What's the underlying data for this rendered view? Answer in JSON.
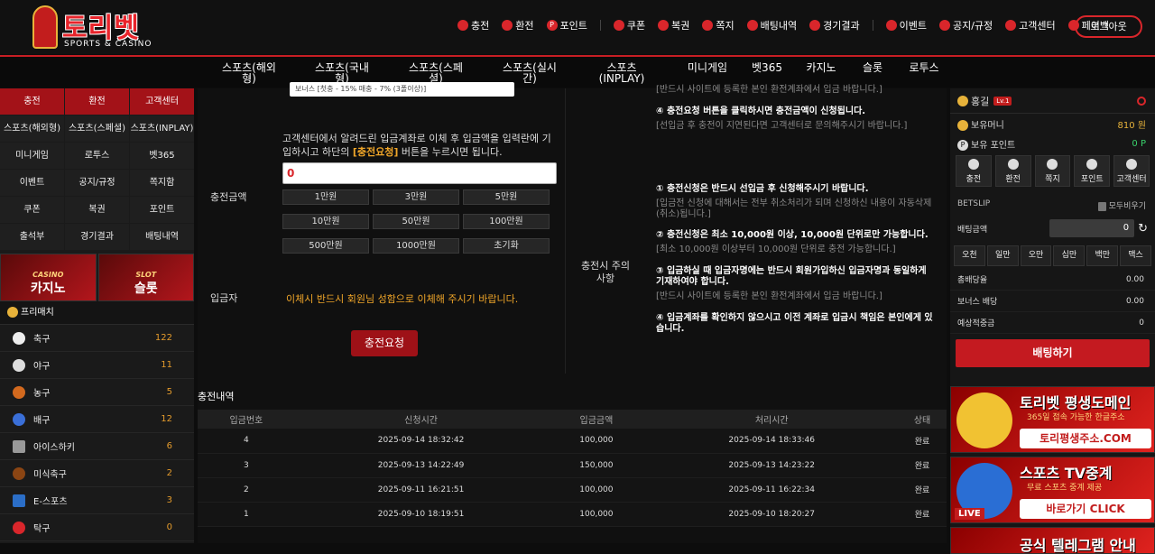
{
  "header": {
    "logo_title": "토리벳",
    "logo_sub": "SPORTS & CASINO",
    "nav": [
      "충전",
      "환전",
      "포인트",
      "쿠폰",
      "복권",
      "쪽지",
      "배팅내역",
      "경기결과",
      "이벤트",
      "공지/규정",
      "고객센터",
      "페이백"
    ],
    "logout": "로그아웃"
  },
  "mainnav": [
    "스포츠(해외형)",
    "스포츠(국내형)",
    "스포츠(스페셜)",
    "스포츠(실시간)",
    "스포츠(INPLAY)",
    "미니게임",
    "벳365",
    "카지노",
    "슬롯",
    "로투스"
  ],
  "left": {
    "grid": [
      "충전",
      "환전",
      "고객센터",
      "스포츠(해외형)",
      "스포츠(스페셜)",
      "스포츠(INPLAY)",
      "미니게임",
      "로투스",
      "벳365",
      "이벤트",
      "공지/규정",
      "쪽지함",
      "쿠폰",
      "복권",
      "포인트",
      "출석부",
      "경기결과",
      "배팅내역"
    ],
    "banner_casino_small": "CASINO",
    "banner_casino": "카지노",
    "banner_slot_small": "SLOT",
    "banner_slot": "슬롯",
    "freematch": "프리매치",
    "sports": [
      {
        "name": "축구",
        "count": "122"
      },
      {
        "name": "야구",
        "count": "11"
      },
      {
        "name": "농구",
        "count": "5"
      },
      {
        "name": "배구",
        "count": "12"
      },
      {
        "name": "아이스하키",
        "count": "6"
      },
      {
        "name": "미식축구",
        "count": "2"
      },
      {
        "name": "E-스포츠",
        "count": "3"
      },
      {
        "name": "탁구",
        "count": "0"
      }
    ]
  },
  "form": {
    "select_value": "보너스 [첫충 - 15% 매충 - 7% (3폴이상)]",
    "instruction_1": "고객센터에서 알려드린 입금계좌로 이체 후 입금액을 입력란에 기입하시고 하단의 ",
    "instruction_bold": "[충전요청]",
    "instruction_2": " 버튼을 누르시면 됩니다.",
    "amount_label": "충전금액",
    "amount_value": "0",
    "amount_buttons": [
      "1만원",
      "3만원",
      "5만원",
      "10만원",
      "50만원",
      "100만원",
      "500만원",
      "1000만원",
      "초기화"
    ],
    "depositor_label": "입금자",
    "depositor_note": "이체시 반드시 회원님 성함으로 이체해 주시기 바랍니다.",
    "submit": "충전요청"
  },
  "notice": {
    "label": "충전시 주의사항",
    "lines": [
      {
        "style": "g",
        "text": "[반드시 사이트에 등록한 본인 환전계좌에서 입금 바랍니다.]"
      },
      {
        "style": "b",
        "text": "④ 충전요청 버튼을 클릭하시면 충전금액이 신청됩니다."
      },
      {
        "style": "g",
        "text": "[선입금 후 충전이 지연된다면 고객센터로 문의해주시기 바랍니다.]"
      },
      {
        "style": "b",
        "text": "① 충전신청은 반드시 선입금 후 신청해주시기 바랍니다."
      },
      {
        "style": "g",
        "text": "[입금전 신청에 대해서는 전부 취소처리가 되며 신청하신 내용이 자동삭제(취소)됩니다.]"
      },
      {
        "style": "b",
        "text": "② 충전신청은 최소 10,000원 이상, 10,000원 단위로만 가능합니다."
      },
      {
        "style": "g",
        "text": "[최소 10,000원 이상부터 10,000원 단위로 충전 가능합니다.]"
      },
      {
        "style": "b",
        "text": "③ 입금하실 때 입금자명에는 반드시 회원가입하신 입금자명과 동일하게 기재하여야 합니다."
      },
      {
        "style": "g",
        "text": "[반드시 사이트에 등록한 본인 환전계좌에서 입금 바랍니다.]"
      },
      {
        "style": "b",
        "text": "④ 입금계좌를 확인하지 않으시고 이전 계좌로 입금시 책임은 본인에게 있습니다."
      }
    ]
  },
  "history": {
    "title": "충전내역",
    "headers": [
      "입금번호",
      "신청시간",
      "입금금액",
      "처리시간",
      "상태"
    ],
    "rows": [
      [
        "4",
        "2025-09-14 18:32:42",
        "100,000",
        "2025-09-14 18:33:46",
        "완료"
      ],
      [
        "3",
        "2025-09-13 14:22:49",
        "150,000",
        "2025-09-13 14:23:22",
        "완료"
      ],
      [
        "2",
        "2025-09-11 16:21:51",
        "100,000",
        "2025-09-11 16:22:34",
        "완료"
      ],
      [
        "1",
        "2025-09-10 18:19:51",
        "100,000",
        "2025-09-10 18:20:27",
        "완료"
      ]
    ]
  },
  "right": {
    "user": "홍길",
    "level": "Lv.1",
    "money_label": "보유머니",
    "money_value": "810 원",
    "point_label": "보유 포인트",
    "point_value": "0 P",
    "quick": [
      "충전",
      "환전",
      "쪽지",
      "포인트",
      "고객센터"
    ],
    "betslip": "BETSLIP",
    "clear_all": "모두비우기",
    "bet_amount_label": "배팅금액",
    "bet_amount_value": "0",
    "chips": [
      "오천",
      "일만",
      "오만",
      "십만",
      "백만",
      "맥스"
    ],
    "total_odds_label": "총배당율",
    "total_odds_value": "0.00",
    "bonus_label": "보너스 배당",
    "bonus_value": "0.00",
    "expected_label": "예상적중금",
    "expected_value": "0",
    "bet_button": "배팅하기",
    "ad1_title": "토리벳 평생도메인",
    "ad1_sub": "365일 접속 가능한 한글주소",
    "ad1_url": "토리평생주소.COM",
    "ad2_title": "스포츠 TV중계",
    "ad2_sub": "무료 스포츠 중계 제공",
    "ad2_cta": "바로가기 CLICK",
    "ad2_live": "LIVE",
    "ad3_title": "공식 텔레그램 안내"
  },
  "colors": {
    "accent": "#c81e24",
    "gold": "#f0a629",
    "bg": "#0d0d0d"
  }
}
